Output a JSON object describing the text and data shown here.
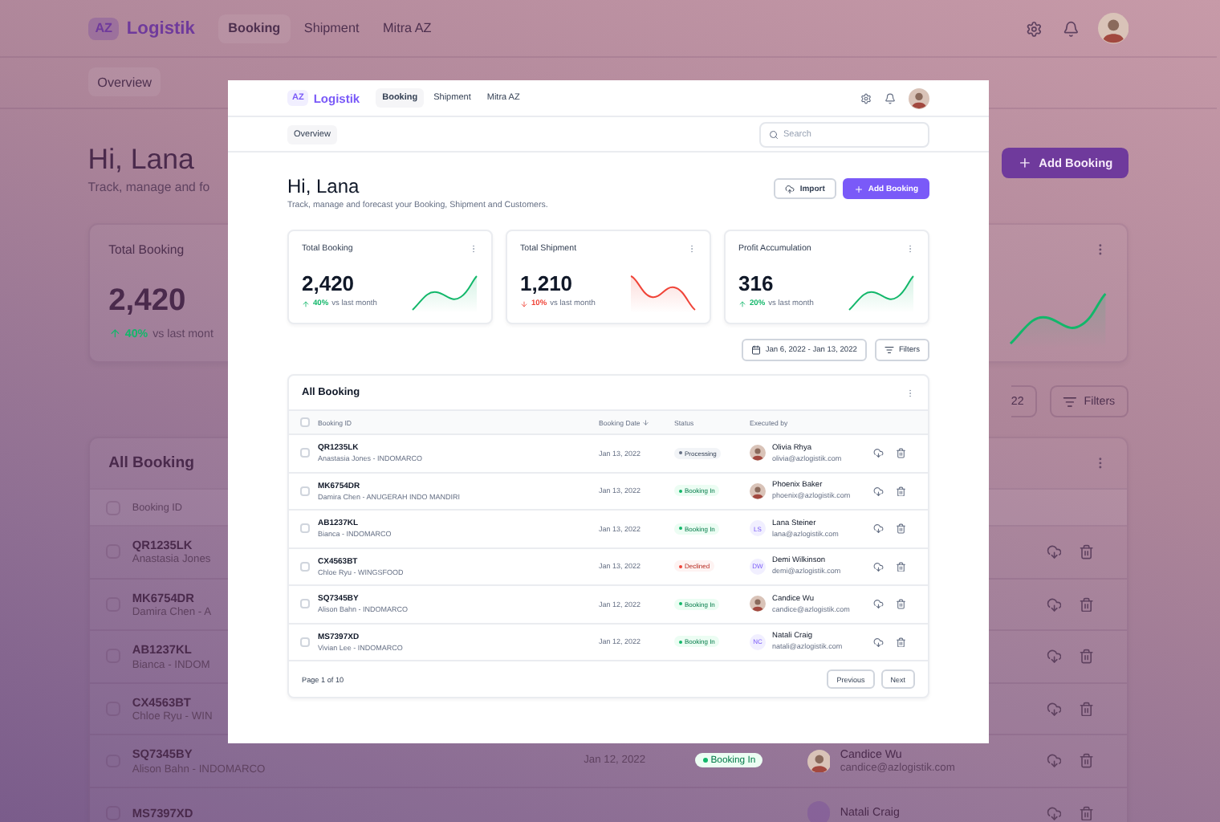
{
  "backdrop": {
    "nav": {
      "logo_badge": "AZ",
      "logo_text": "Logistik",
      "links": [
        {
          "label": "Booking",
          "selected": true
        },
        {
          "label": "Shipment",
          "selected": false
        },
        {
          "label": "Mitra AZ",
          "selected": false
        }
      ]
    },
    "subnav": {
      "tab": "Overview"
    },
    "header": {
      "greeting": "Hi, Lana",
      "subtitle": "Track, manage and fo",
      "add_button": "Add Booking"
    },
    "stats": [
      {
        "title": "Total Booking",
        "value": "2,420",
        "kind": "up",
        "change": "40%",
        "note": "vs last mont"
      },
      {
        "kind": "up",
        "sparkline": true,
        "menu": true
      }
    ],
    "toolbar": {
      "date_range": "22",
      "filters": "Filters"
    },
    "table": {
      "title": "All Booking",
      "menu": true,
      "header_checked": false,
      "columns": [
        {
          "label": "Booking ID",
          "sorted": false
        }
      ],
      "rows": [
        {
          "checked": false,
          "id": "QR1235LK",
          "client": "Anastasia Jones"
        },
        {
          "checked": false,
          "id": "MK6754DR",
          "client": "Damira Chen - A"
        },
        {
          "checked": false,
          "id": "AB1237KL",
          "client": "Bianca - INDOM"
        },
        {
          "checked": false,
          "id": "CX4563BT",
          "client": "Chloe Ryu - WIN"
        },
        {
          "checked": false,
          "id": "SQ7345BY",
          "client": "Alison Bahn - INDOMARCO",
          "date": "Jan 12, 2022",
          "status": {
            "label": "Booking In",
            "kind": "booking_in"
          },
          "executor": {
            "kind": "photo",
            "name": "Candice Wu",
            "email": "candice@azlogistik.com"
          }
        },
        {
          "checked": false,
          "id": "MS7397XD",
          "executor": {
            "kind": "initials",
            "name": "Natali Craig"
          }
        }
      ]
    }
  },
  "screen": {
    "nav": {
      "logo_badge": "AZ",
      "logo_text": "Logistik",
      "links": [
        {
          "label": "Booking",
          "selected": true
        },
        {
          "label": "Shipment",
          "selected": false
        },
        {
          "label": "Mitra AZ",
          "selected": false
        }
      ]
    },
    "subnav": {
      "tab": "Overview",
      "search_placeholder": "Search"
    },
    "header": {
      "greeting": "Hi, Lana",
      "subtitle": "Track, manage and forecast your Booking, Shipment and Customers.",
      "import_button": "Import",
      "add_button": "Add Booking"
    },
    "stats": [
      {
        "title": "Total Booking",
        "value": "2,420",
        "kind": "up",
        "change": "40%",
        "note": "vs last month",
        "sparkline": true,
        "menu": true
      },
      {
        "title": "Total Shipment",
        "value": "1,210",
        "kind": "down",
        "change": "10%",
        "note": "vs last month",
        "sparkline": true,
        "menu": true
      },
      {
        "title": "Profit Accumulation",
        "value": "316",
        "kind": "up",
        "change": "20%",
        "note": "vs last month",
        "sparkline": true,
        "menu": true
      }
    ],
    "toolbar": {
      "date_range": "Jan 6, 2022 - Jan 13, 2022",
      "filters": "Filters"
    },
    "table": {
      "title": "All Booking",
      "menu": true,
      "header_checked": false,
      "columns": [
        {
          "label": "Booking ID",
          "sorted": false
        },
        {
          "label": "Booking Date",
          "sorted": true
        },
        {
          "label": "Status",
          "sorted": false
        },
        {
          "label": "Executed by",
          "sorted": false
        }
      ],
      "rows": [
        {
          "checked": false,
          "id": "QR1235LK",
          "client": "Anastasia Jones - INDOMARCO",
          "date": "Jan 13, 2022",
          "status": {
            "label": "Processing",
            "kind": "processing"
          },
          "executor": {
            "kind": "photo",
            "name": "Olivia Rhya",
            "email": "olivia@azlogistik.com"
          }
        },
        {
          "checked": false,
          "id": "MK6754DR",
          "client": "Damira Chen - ANUGERAH INDO MANDIRI",
          "date": "Jan 13, 2022",
          "status": {
            "label": "Booking In",
            "kind": "booking_in"
          },
          "executor": {
            "kind": "photo",
            "name": "Phoenix Baker",
            "email": "phoenix@azlogistik.com"
          }
        },
        {
          "checked": false,
          "id": "AB1237KL",
          "client": "Bianca - INDOMARCO",
          "date": "Jan 13, 2022",
          "status": {
            "label": "Booking In",
            "kind": "booking_in"
          },
          "executor": {
            "kind": "initials",
            "initials": "LS",
            "name": "Lana Steiner",
            "email": "lana@azlogistik.com"
          }
        },
        {
          "checked": false,
          "id": "CX4563BT",
          "client": "Chloe Ryu - WINGSFOOD",
          "date": "Jan 13, 2022",
          "status": {
            "label": "Declined",
            "kind": "declined"
          },
          "executor": {
            "kind": "initials",
            "initials": "DW",
            "name": "Demi Wilkinson",
            "email": "demi@azlogistik.com"
          }
        },
        {
          "checked": false,
          "id": "SQ7345BY",
          "client": "Alison Bahn - INDOMARCO",
          "date": "Jan 12, 2022",
          "status": {
            "label": "Booking In",
            "kind": "booking_in"
          },
          "executor": {
            "kind": "photo",
            "name": "Candice Wu",
            "email": "candice@azlogistik.com"
          }
        },
        {
          "checked": false,
          "id": "MS7397XD",
          "client": "Vivian Lee - INDOMARCO",
          "date": "Jan 12, 2022",
          "status": {
            "label": "Booking In",
            "kind": "booking_in"
          },
          "executor": {
            "kind": "initials",
            "initials": "NC",
            "name": "Natali Craig",
            "email": "natali@azlogistik.com"
          }
        }
      ],
      "footer": {
        "page": "Page 1 of 10",
        "previous": "Previous",
        "next": "Next"
      }
    }
  }
}
